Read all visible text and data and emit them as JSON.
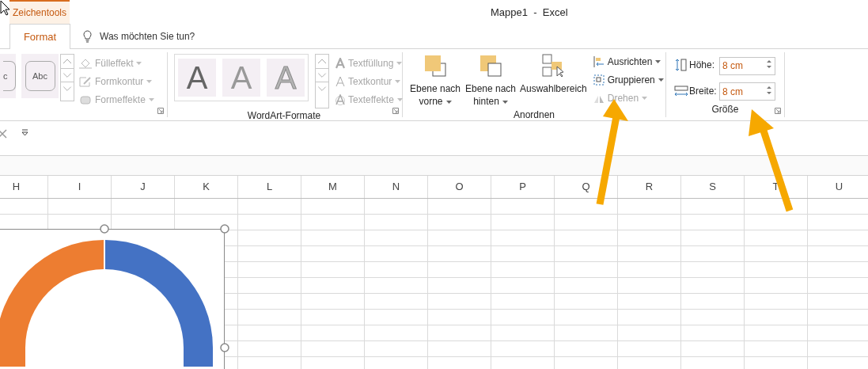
{
  "title_bar": {
    "context_tab": "Zeichentools",
    "title": "Mappe1  -  Excel"
  },
  "tabs": [
    {
      "label": "Format",
      "selected": true
    }
  ],
  "tell_me": {
    "placeholder": "Was möchten Sie tun?"
  },
  "shape_styles": {
    "thumbnails": [
      {
        "label": "c"
      },
      {
        "label": "Abc"
      }
    ],
    "commands": [
      {
        "label": "Fülleffekt",
        "disabled": true,
        "dropdown": true
      },
      {
        "label": "Formkontur",
        "disabled": true,
        "dropdown": true
      },
      {
        "label": "Formeffekte",
        "disabled": true,
        "dropdown": true
      }
    ]
  },
  "wordart": {
    "label": "WordArt-Formate",
    "thumbnails": [
      {
        "letter": "A"
      },
      {
        "letter": "A"
      },
      {
        "letter": "A"
      }
    ],
    "commands": [
      {
        "label": "Textfüllung",
        "disabled": true,
        "dropdown": true
      },
      {
        "label": "Textkontur",
        "disabled": true,
        "dropdown": true
      },
      {
        "label": "Texteffekte",
        "disabled": true,
        "dropdown": true
      }
    ]
  },
  "arrange": {
    "label": "Anordnen",
    "large_buttons": [
      {
        "label": "Ebene nach vorne",
        "dropdown": true
      },
      {
        "label": "Ebene nach hinten",
        "dropdown": true
      },
      {
        "label": "Auswahlbereich",
        "dropdown": false
      }
    ],
    "commands": [
      {
        "label": "Ausrichten",
        "disabled": false,
        "dropdown": true
      },
      {
        "label": "Gruppieren",
        "disabled": false,
        "dropdown": true
      },
      {
        "label": "Drehen",
        "disabled": true,
        "dropdown": true
      }
    ]
  },
  "size": {
    "label": "Größe",
    "fields": [
      {
        "label": "Höhe:",
        "value": "8 cm"
      },
      {
        "label": "Breite:",
        "value": "8 cm"
      }
    ]
  },
  "columns": [
    "H",
    "I",
    "J",
    "K",
    "L",
    "M",
    "N",
    "O",
    "P",
    "Q",
    "R",
    "S",
    "T",
    "U"
  ]
}
